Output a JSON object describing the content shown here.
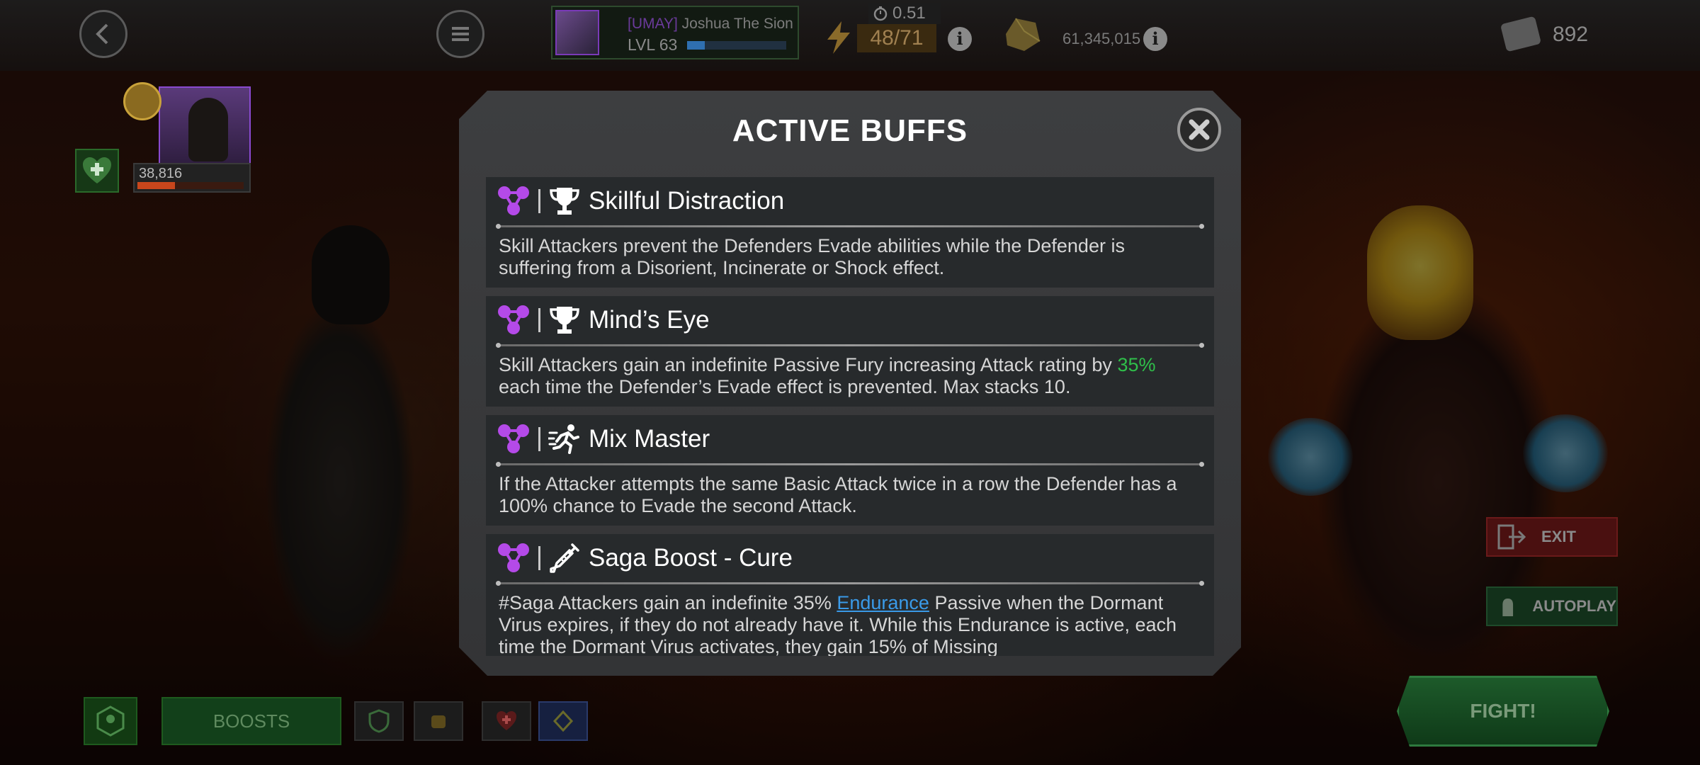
{
  "topbar": {
    "summoner_tag": "[UMAY]",
    "summoner_name": "Joshua The Sion",
    "summoner_level": "LVL 63",
    "xp_fraction": 0.18,
    "timer": "0.51",
    "energy": "48/71",
    "gold": "61,345,015",
    "units": "892",
    "info_glyph": "i"
  },
  "hero": {
    "hp": "38,816",
    "hp_fraction": 0.35
  },
  "modal": {
    "title": "ACTIVE BUFFS",
    "buffs": [
      {
        "name": "Skillful Distraction",
        "icon": "trophy-icon",
        "desc": "Skill Attackers prevent the Defenders Evade abilities while the Defender is suffering from a Disorient, Incinerate or Shock effect."
      },
      {
        "name": "Mind’s Eye",
        "icon": "trophy-icon",
        "desc_pre": "Skill Attackers gain an indefinite Passive Fury increasing Attack rating by ",
        "desc_highlight": "35%",
        "desc_post": " each time the Defender’s Evade effect is prevented. Max stacks 10."
      },
      {
        "name": "Mix Master",
        "icon": "running-man-icon",
        "desc": "If the Attacker attempts the same Basic Attack twice in a row the Defender has a 100% chance to Evade the second Attack."
      },
      {
        "name": "Saga Boost - Cure",
        "icon": "syringe-icon",
        "desc_pre": "#Saga Attackers gain an indefinite 35% ",
        "desc_link": "Endurance",
        "desc_post": " Passive when the Dormant Virus expires, if they do not already have it. While this Endurance is active, each time the Dormant Virus activates, they gain 15% of Missing"
      }
    ]
  },
  "buttons": {
    "exit": "EXIT",
    "autoplay": "AUTOPLAY",
    "fight": "FIGHT!",
    "boosts": "BOOSTS"
  },
  "colors": {
    "accent_green": "#2fbf4a",
    "link_blue": "#3a9ae8",
    "buff_purple": "#b44ae8"
  }
}
